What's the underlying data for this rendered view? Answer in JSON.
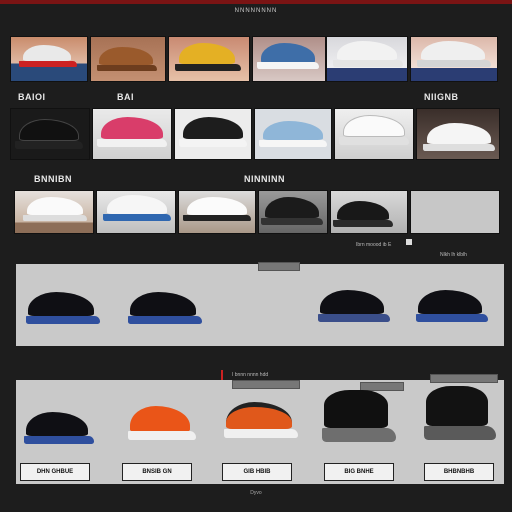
{
  "header": {
    "title": "NNNNNNNN"
  },
  "sections": {
    "row2_left": "BAIOI",
    "row2_mid": "BAI",
    "row2_right": "NIIGNB",
    "row3_left": "BNNIBN",
    "row3_right": "NINNINN"
  },
  "panels": {
    "top_info": "Ibrn moood ib E",
    "top_info_right": "Nlkh lh klblh",
    "bottom_info": "I bnnn nnnn hdd"
  },
  "captions": [
    "DHN GHBUE",
    "BNSIB GN",
    "GIB HBIB",
    "BIG BNHE",
    "BHBNBHB"
  ],
  "footer": {
    "text": "Dyvo"
  },
  "colors": {
    "accent": "#7a1414",
    "panel": "#c9c9c9",
    "background": "#1d1d1d"
  }
}
